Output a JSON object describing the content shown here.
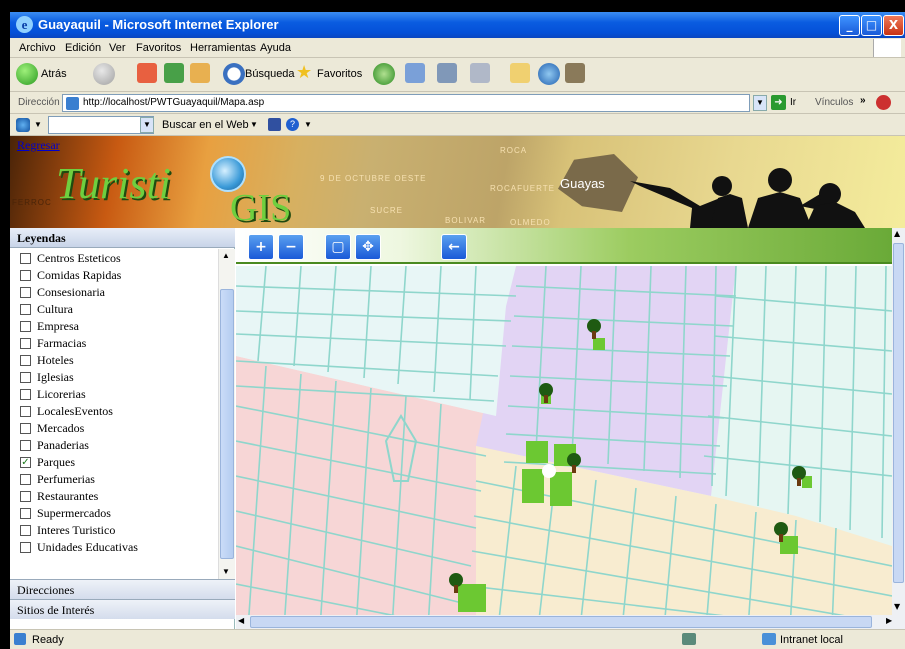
{
  "window": {
    "title": "Guayaquil - Microsoft Internet Explorer",
    "controls": [
      "_",
      "□",
      "X"
    ]
  },
  "menu": [
    "Archivo",
    "Edición",
    "Ver",
    "Favoritos",
    "Herramientas",
    "Ayuda"
  ],
  "toolbar": {
    "back": "Atrás",
    "search": "Búsqueda",
    "favorites": "Favoritos"
  },
  "address": {
    "label": "Dirección",
    "url": "http://localhost/PWTGuayaquil/Mapa.asp",
    "go": "Ir",
    "links": "Vínculos"
  },
  "linksbar": {
    "search_web": "Buscar en el Web"
  },
  "banner": {
    "back_link": "Regresar",
    "logo_part1": "Turisti",
    "logo_part2": "GIS",
    "region": "Guayas",
    "streets": [
      "9 DE OCTUBRE OESTE",
      "ROCA",
      "ROCAFUERTE",
      "SUCRE",
      "BOLIVAR",
      "OLMEDO",
      "FERROC"
    ]
  },
  "legend": {
    "header": "Leyendas",
    "items": [
      {
        "label": "Centros Esteticos",
        "checked": false
      },
      {
        "label": "Comidas Rapidas",
        "checked": false
      },
      {
        "label": "Consesionaria",
        "checked": false
      },
      {
        "label": "Cultura",
        "checked": false
      },
      {
        "label": "Empresa",
        "checked": false
      },
      {
        "label": "Farmacias",
        "checked": false
      },
      {
        "label": "Hoteles",
        "checked": false
      },
      {
        "label": "Iglesias",
        "checked": false
      },
      {
        "label": "Licorerias",
        "checked": false
      },
      {
        "label": "LocalesEventos",
        "checked": false
      },
      {
        "label": "Mercados",
        "checked": false
      },
      {
        "label": "Panaderias",
        "checked": false
      },
      {
        "label": "Parques",
        "checked": true
      },
      {
        "label": "Perfumerias",
        "checked": false
      },
      {
        "label": "Restaurantes",
        "checked": false
      },
      {
        "label": "Supermercados",
        "checked": false
      },
      {
        "label": "Interes Turistico",
        "checked": false
      },
      {
        "label": "Unidades Educativas",
        "checked": false
      }
    ]
  },
  "sections": {
    "directions": "Direcciones",
    "interest": "Sitios de Interés"
  },
  "map_tools": [
    "zoom-in",
    "zoom-out",
    "full-extent",
    "pan",
    "back"
  ],
  "status": {
    "text": "Ready",
    "zone": "Intranet local"
  },
  "colors": {
    "zone_pink": "#f7d6d6",
    "zone_purple": "#e2d4f4",
    "zone_cream": "#f8ecd0",
    "zone_mint": "#e2f6ec",
    "street": "#7ecfc8",
    "park": "#6cc832"
  }
}
